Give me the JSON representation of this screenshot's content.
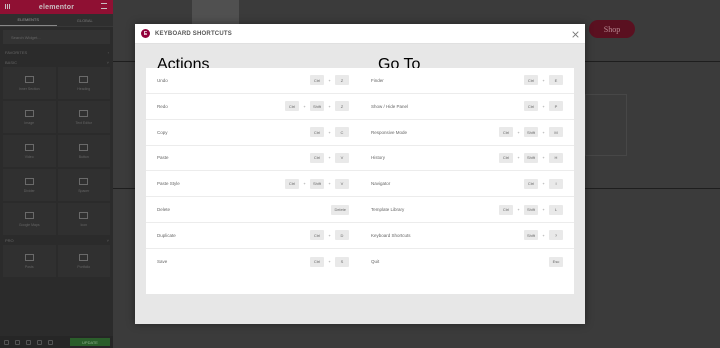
{
  "panel": {
    "logo": "elementor",
    "tabs": [
      "ELEMENTS",
      "GLOBAL"
    ],
    "search_placeholder": "Search Widget...",
    "sections": [
      "FAVORITES",
      "BASIC",
      "PRO"
    ],
    "widgets": [
      "Inner Section",
      "Heading",
      "Image",
      "Text Editor",
      "Video",
      "Button",
      "Divider",
      "Spacer",
      "Google Maps",
      "Icon",
      "Posts",
      "Portfolio",
      "Slides",
      "Form"
    ],
    "footer_button": "UPDATE"
  },
  "canvas": {
    "shop_label": "Shop"
  },
  "modal": {
    "title": "KEYBOARD SHORTCUTS",
    "actions_heading": "Actions",
    "goto_heading": "Go To",
    "actions": [
      {
        "label": "Undo",
        "keys": [
          "Ctrl",
          "Z"
        ]
      },
      {
        "label": "Redo",
        "keys": [
          "Ctrl",
          "Shift",
          "Z"
        ]
      },
      {
        "label": "Copy",
        "keys": [
          "Ctrl",
          "C"
        ]
      },
      {
        "label": "Paste",
        "keys": [
          "Ctrl",
          "V"
        ]
      },
      {
        "label": "Paste Style",
        "keys": [
          "Ctrl",
          "Shift",
          "V"
        ]
      },
      {
        "label": "Delete",
        "keys": [
          "Delete"
        ]
      },
      {
        "label": "Duplicate",
        "keys": [
          "Ctrl",
          "D"
        ]
      },
      {
        "label": "Save",
        "keys": [
          "Ctrl",
          "S"
        ]
      }
    ],
    "goto": [
      {
        "label": "Finder",
        "keys": [
          "Ctrl",
          "E"
        ]
      },
      {
        "label": "Show / Hide Panel",
        "keys": [
          "Ctrl",
          "P"
        ]
      },
      {
        "label": "Responsive Mode",
        "keys": [
          "Ctrl",
          "Shift",
          "M"
        ]
      },
      {
        "label": "History",
        "keys": [
          "Ctrl",
          "Shift",
          "H"
        ]
      },
      {
        "label": "Navigator",
        "keys": [
          "Ctrl",
          "I"
        ]
      },
      {
        "label": "Template Library",
        "keys": [
          "Ctrl",
          "Shift",
          "L"
        ]
      },
      {
        "label": "Keyboard Shortcuts",
        "keys": [
          "Shift",
          "?"
        ]
      },
      {
        "label": "Quit",
        "keys": [
          "Esc"
        ]
      }
    ]
  },
  "colors": {
    "brand": "#92003b",
    "overlay": "#3a3a3a",
    "card": "#ffffff",
    "key_bg": "#e9e9e9"
  }
}
